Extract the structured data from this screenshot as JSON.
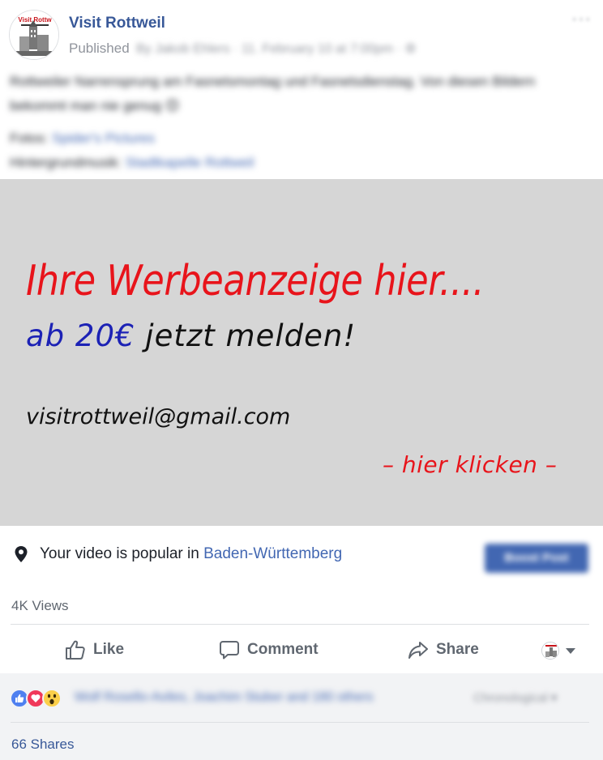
{
  "header": {
    "page_name": "Visit Rottweil",
    "status": "Published",
    "meta_blurred": "By Jakob Ehlers · 11. February 10 at 7:00pm · ⚙",
    "more": "···"
  },
  "post": {
    "text": "Rottweiler Narrensprung am Fasnetsmontag und Fasnetsdienstag. Von diesen Bildern bekommt man nie genug 😊",
    "credits_label_1": "Fotos:",
    "credits_link_1": "Spider's Pictures",
    "credits_label_2": "Hintergrundmusik:",
    "credits_link_2": "Stadtkapelle Rottweil"
  },
  "ad": {
    "headline": "Ihre Werbeanzeige hier....",
    "price": "ab 20€",
    "sub_rest": " jetzt melden!",
    "email": "visitrottweil@gmail.com",
    "click": "– hier klicken –"
  },
  "popular": {
    "text": "Your video is popular in ",
    "region": "Baden-Württemberg",
    "button": "Boost Post"
  },
  "stats": {
    "views": "4K Views",
    "shares": "66 Shares"
  },
  "actions": {
    "like": "Like",
    "comment": "Comment",
    "share": "Share"
  },
  "reactions": {
    "summary": "Wolf Rosello-Aviles, Joachim Stuber and 180 others",
    "order": "Chronological ▾"
  },
  "colors": {
    "brand_blue": "#4267b2",
    "page_name_blue": "#385898",
    "ad_red": "#e8141b",
    "ad_price_blue": "#1c22b5",
    "ad_bg": "#d6d6d6"
  }
}
